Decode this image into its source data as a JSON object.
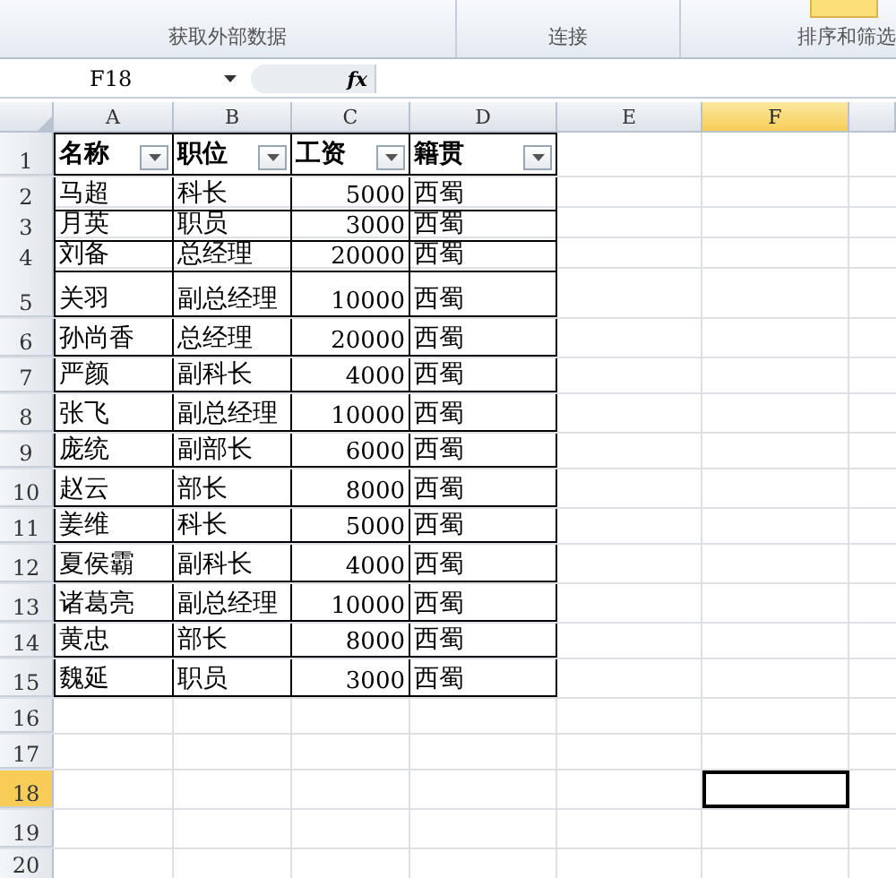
{
  "ribbon": {
    "groups": [
      {
        "label": "获取外部数据"
      },
      {
        "label": "连接"
      },
      {
        "label": "排序和筛选"
      }
    ]
  },
  "formula_bar": {
    "name_box": "F18",
    "fx": "fx"
  },
  "columns": [
    {
      "label": "A",
      "selected": false
    },
    {
      "label": "B",
      "selected": false
    },
    {
      "label": "C",
      "selected": false
    },
    {
      "label": "D",
      "selected": false
    },
    {
      "label": "E",
      "selected": false
    },
    {
      "label": "F",
      "selected": true
    }
  ],
  "rows": [
    {
      "number": "1",
      "selected": false,
      "kind": "header",
      "cells": [
        "名称",
        "职位",
        "工资",
        "籍贯"
      ]
    },
    {
      "number": "2",
      "selected": false,
      "kind": "data",
      "cells": [
        "马超",
        "科长",
        "5000",
        "西蜀"
      ]
    },
    {
      "number": "3",
      "selected": false,
      "kind": "data",
      "cells": [
        "月英",
        "职员",
        "3000",
        "西蜀"
      ]
    },
    {
      "number": "4",
      "selected": false,
      "kind": "data",
      "cells": [
        "刘备",
        "总经理",
        "20000",
        "西蜀"
      ]
    },
    {
      "number": "5",
      "selected": false,
      "kind": "data",
      "cells": [
        "关羽",
        "副总经理",
        "10000",
        "西蜀"
      ]
    },
    {
      "number": "6",
      "selected": false,
      "kind": "data",
      "cells": [
        "孙尚香",
        "总经理",
        "20000",
        "西蜀"
      ]
    },
    {
      "number": "7",
      "selected": false,
      "kind": "data",
      "cells": [
        "严颜",
        "副科长",
        "4000",
        "西蜀"
      ]
    },
    {
      "number": "8",
      "selected": false,
      "kind": "data",
      "cells": [
        "张飞",
        "副总经理",
        "10000",
        "西蜀"
      ]
    },
    {
      "number": "9",
      "selected": false,
      "kind": "data",
      "cells": [
        "庞统",
        "副部长",
        "6000",
        "西蜀"
      ]
    },
    {
      "number": "10",
      "selected": false,
      "kind": "data",
      "cells": [
        "赵云",
        "部长",
        "8000",
        "西蜀"
      ]
    },
    {
      "number": "11",
      "selected": false,
      "kind": "data",
      "cells": [
        "姜维",
        "科长",
        "5000",
        "西蜀"
      ]
    },
    {
      "number": "12",
      "selected": false,
      "kind": "data",
      "cells": [
        "夏侯霸",
        "副科长",
        "4000",
        "西蜀"
      ]
    },
    {
      "number": "13",
      "selected": false,
      "kind": "data",
      "cells": [
        "诸葛亮",
        "副总经理",
        "10000",
        "西蜀"
      ]
    },
    {
      "number": "14",
      "selected": false,
      "kind": "data",
      "cells": [
        "黄忠",
        "部长",
        "8000",
        "西蜀"
      ]
    },
    {
      "number": "15",
      "selected": false,
      "kind": "data",
      "cells": [
        "魏延",
        "职员",
        "3000",
        "西蜀"
      ]
    },
    {
      "number": "16",
      "selected": false,
      "kind": "empty"
    },
    {
      "number": "17",
      "selected": false,
      "kind": "empty"
    },
    {
      "number": "18",
      "selected": true,
      "kind": "empty"
    },
    {
      "number": "19",
      "selected": false,
      "kind": "empty"
    },
    {
      "number": "20",
      "selected": false,
      "kind": "empty"
    }
  ]
}
